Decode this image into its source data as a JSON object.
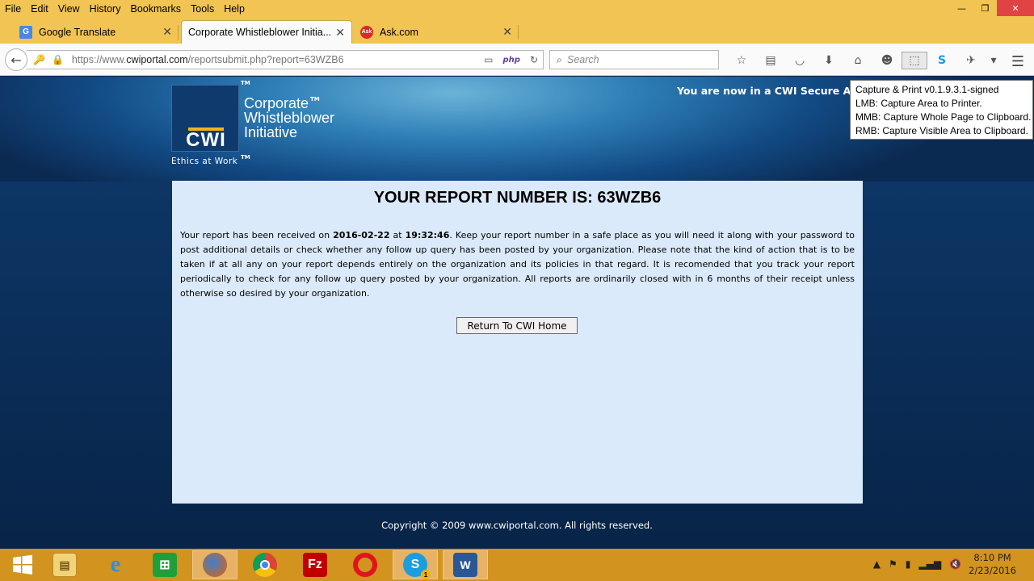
{
  "menu": [
    "File",
    "Edit",
    "View",
    "History",
    "Bookmarks",
    "Tools",
    "Help"
  ],
  "window_controls": {
    "minimize": "—",
    "restore": "❐",
    "close": "✕"
  },
  "tabs": [
    {
      "label": "Google Translate",
      "icon": "google-translate-icon"
    },
    {
      "label": "Corporate Whistleblower Initia...",
      "icon": "none",
      "active": true
    },
    {
      "label": "Ask.com",
      "icon": "ask-icon"
    }
  ],
  "address": {
    "prefix": "https://www.",
    "domain": "cwiportal.com",
    "path": "/reportsubmit.php?report=63WZB6",
    "php_badge": "php"
  },
  "search": {
    "placeholder": "Search"
  },
  "page": {
    "logo_abbr": "CWI",
    "logo_line1": "Corporate",
    "logo_line2": "Whistleblower",
    "logo_line3": "Initiative",
    "tagline": "Ethics at Work",
    "tm": "TM",
    "secure_notice": "You are now in a CWI Secure Ar",
    "heading": "YOUR REPORT NUMBER IS: 63WZB6",
    "body_part1": "Your report has been received on ",
    "date": "2016-02-22",
    "body_part2": " at ",
    "time": "19:32:46",
    "body_part3": ". Keep your report number in a safe place as you will need it along with your password to post additional details or check whether any follow up query has been posted by your organization. Please note that the kind of action that is to be taken if at all any on your report depends entirely on the organization and its policies in that regard. It is recomended that you track your report periodically to check for any follow up query posted by your organization. All reports are ordinarily closed with in 6 months of their receipt unless otherwise so desired by your organization.",
    "return_button": "Return To CWI Home",
    "copyright": "Copyright © 2009 www.cwiportal.com. All rights reserved."
  },
  "tooltip": {
    "line1": "Capture & Print v0.1.9.3.1-signed",
    "line2": "LMB: Capture Area to Printer.",
    "line3": "MMB: Capture Whole Page to Clipboard.",
    "line4": "RMB: Capture Visible Area to Clipboard."
  },
  "taskbar": {
    "apps": [
      "windows-start",
      "file-explorer",
      "internet-explorer",
      "store",
      "firefox",
      "chrome",
      "filezilla",
      "opera",
      "skype",
      "word"
    ],
    "skype_badge": "1",
    "time": "8:10 PM",
    "date": "2/23/2016"
  },
  "colors": {
    "menubar": "#f1c453",
    "panel": "#dbeafb",
    "taskbar": "#d2931f",
    "close": "#e04343"
  }
}
